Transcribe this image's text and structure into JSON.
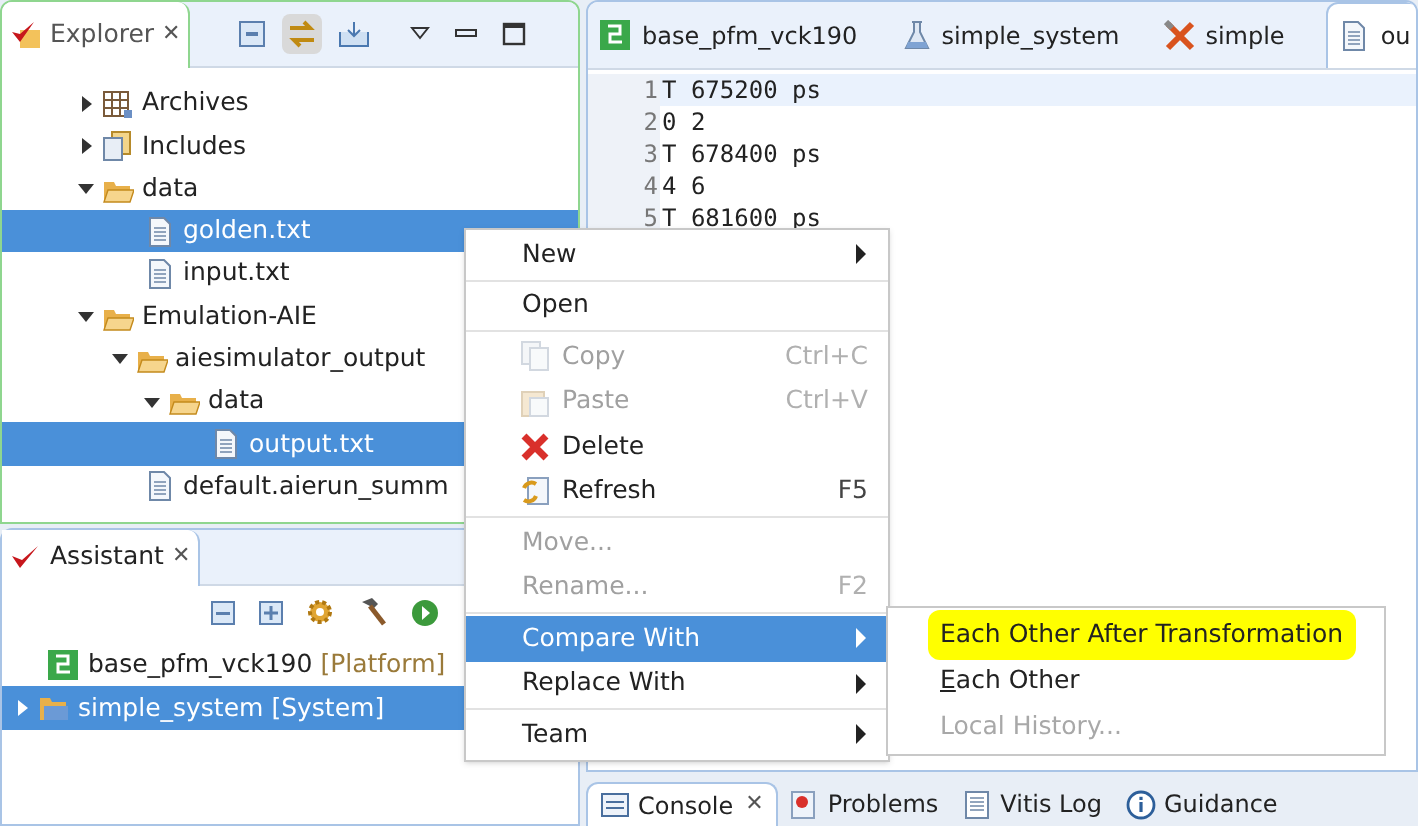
{
  "explorer": {
    "title": "Explorer",
    "close": "✕",
    "tree": [
      {
        "label": "Archives",
        "kind": "archive",
        "expanded": false,
        "selected": false
      },
      {
        "label": "Includes",
        "kind": "include",
        "expanded": false,
        "selected": false
      },
      {
        "label": "data",
        "kind": "folder",
        "expanded": true,
        "selected": false,
        "children": [
          {
            "label": "golden.txt",
            "kind": "file",
            "selected": true
          },
          {
            "label": "input.txt",
            "kind": "file",
            "selected": false
          }
        ]
      },
      {
        "label": "Emulation-AIE",
        "kind": "folder",
        "expanded": true,
        "selected": false,
        "children": [
          {
            "label": "aiesimulator_output",
            "kind": "folder",
            "expanded": true,
            "selected": false,
            "children": [
              {
                "label": "data",
                "kind": "folder",
                "expanded": true,
                "selected": false,
                "children": [
                  {
                    "label": "output.txt",
                    "kind": "file",
                    "selected": true
                  }
                ]
              }
            ]
          },
          {
            "label": "default.aierun_summ",
            "kind": "file",
            "selected": false
          }
        ]
      }
    ]
  },
  "assistant": {
    "title": "Assistant",
    "close": "✕",
    "tree": [
      {
        "label": "base_pfm_vck190",
        "tag": "[Platform]",
        "kind": "platform",
        "selected": false
      },
      {
        "label": "simple_system",
        "tag": "[System]",
        "kind": "system",
        "expanded": false,
        "selected": true
      }
    ]
  },
  "editor": {
    "tabs": [
      {
        "label": "base_pfm_vck190",
        "kind": "platform",
        "selected": false
      },
      {
        "label": "simple_system",
        "kind": "flask",
        "selected": false
      },
      {
        "label": "simple",
        "kind": "tools",
        "selected": false
      },
      {
        "label": "ou",
        "kind": "file",
        "selected": true
      }
    ],
    "lines": [
      {
        "number": "1",
        "text": "T 675200 ps"
      },
      {
        "number": "2",
        "text": "0 2"
      },
      {
        "number": "3",
        "text": "T 678400 ps"
      },
      {
        "number": "4",
        "text": "4 6"
      },
      {
        "number": "5",
        "text": "T 681600 ps"
      }
    ]
  },
  "bottom_tabs": [
    {
      "label": "Console",
      "kind": "console",
      "selected": true,
      "close": "✕"
    },
    {
      "label": "Problems",
      "kind": "problems",
      "selected": false
    },
    {
      "label": "Vitis Log",
      "kind": "log",
      "selected": false
    },
    {
      "label": "Guidance",
      "kind": "info",
      "selected": false
    }
  ],
  "context_menu": [
    {
      "kind": "item",
      "label": "New",
      "submenu": true,
      "disabled": false,
      "selected": false
    },
    {
      "kind": "separator"
    },
    {
      "kind": "item",
      "label": "Open",
      "disabled": false,
      "selected": false
    },
    {
      "kind": "separator"
    },
    {
      "kind": "copy",
      "label": "Copy",
      "shortcut": "Ctrl+C",
      "disabled": true,
      "selected": false
    },
    {
      "kind": "paste",
      "label": "Paste",
      "shortcut": "Ctrl+V",
      "disabled": true,
      "selected": false
    },
    {
      "kind": "delete",
      "label": "Delete",
      "disabled": false,
      "selected": false
    },
    {
      "kind": "refresh",
      "label": "Refresh",
      "shortcut": "F5",
      "disabled": false,
      "selected": false
    },
    {
      "kind": "separator"
    },
    {
      "kind": "item",
      "label": "Move...",
      "disabled": true,
      "selected": false
    },
    {
      "kind": "item",
      "label": "Rename...",
      "shortcut": "F2",
      "disabled": true,
      "selected": false
    },
    {
      "kind": "separator"
    },
    {
      "kind": "item",
      "label": "Compare With",
      "submenu": true,
      "disabled": false,
      "selected": true
    },
    {
      "kind": "item",
      "label": "Replace With",
      "submenu": true,
      "disabled": false,
      "selected": false
    },
    {
      "kind": "separator"
    },
    {
      "kind": "item",
      "label": "Team",
      "submenu": true,
      "disabled": false,
      "selected": false
    }
  ],
  "submenu": [
    {
      "label": "Each Other After Transformation",
      "disabled": false,
      "highlighted": true
    },
    {
      "label": "Each Other",
      "mnemonic_underlined": true,
      "disabled": false,
      "highlighted": false
    },
    {
      "label": "Local History...",
      "disabled": true,
      "highlighted": false
    }
  ]
}
